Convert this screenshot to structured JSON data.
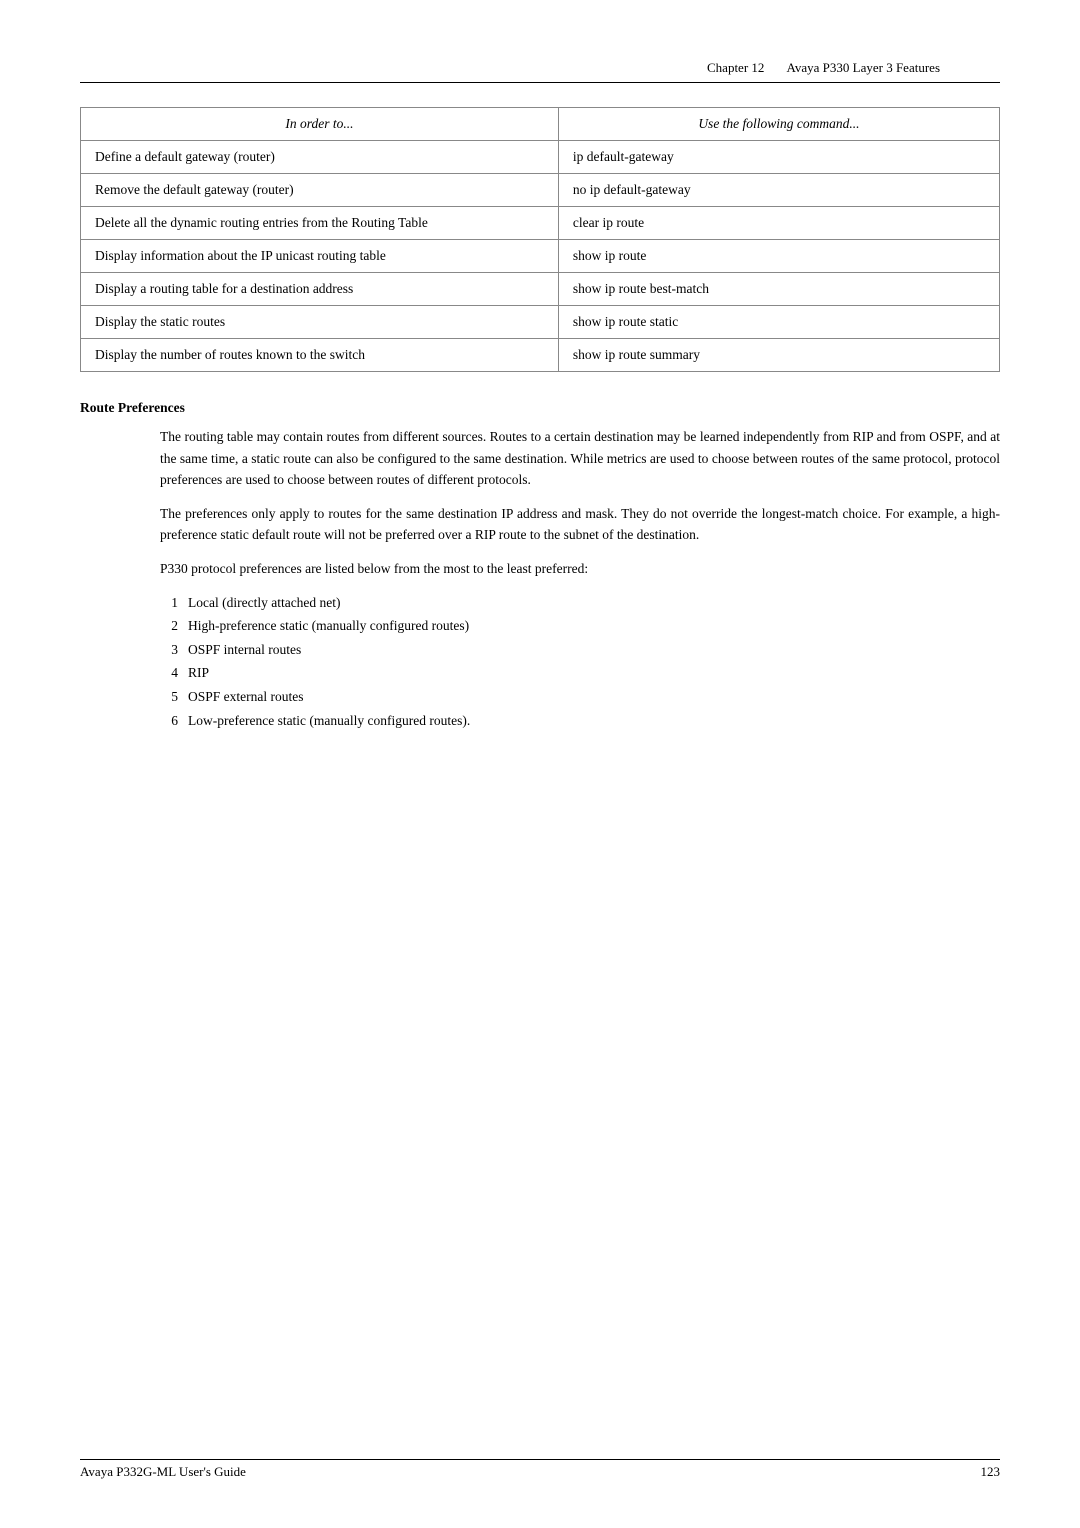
{
  "header": {
    "chapter": "Chapter 12",
    "title": "Avaya P330 Layer 3 Features"
  },
  "table": {
    "col1_header": "In order to...",
    "col2_header": "Use the following command...",
    "rows": [
      {
        "action": "Define a default gateway (router)",
        "command": "ip default-gateway"
      },
      {
        "action": "Remove the default gateway (router)",
        "command": "no ip default-gateway"
      },
      {
        "action": "Delete all the dynamic routing entries from the Routing Table",
        "command": "clear ip route"
      },
      {
        "action": "Display information about the IP unicast routing table",
        "command": "show ip route"
      },
      {
        "action": "Display a routing table for a destination address",
        "command": "show ip route best-match"
      },
      {
        "action": "Display the static routes",
        "command": "show ip route static"
      },
      {
        "action": "Display the number of routes known to the switch",
        "command": "show ip route summary"
      }
    ]
  },
  "route_preferences": {
    "heading": "Route Preferences",
    "paragraph1": "The routing table may contain routes from different sources. Routes to a certain destination may be learned independently from RIP and from OSPF, and at the same time, a static route can also be configured to the same destination. While metrics are used to choose between routes of the same protocol, protocol preferences are used to choose between routes of different protocols.",
    "paragraph2": "The preferences only apply to routes for the same destination IP address and mask. They do not override the longest-match choice. For example, a high-preference static default route will not be preferred over a RIP route to the subnet of the destination.",
    "paragraph3": "P330 protocol preferences are listed below from the most to the least preferred:",
    "items": [
      {
        "num": "1",
        "text": "Local (directly attached net)"
      },
      {
        "num": "2",
        "text": "High-preference static (manually configured routes)"
      },
      {
        "num": "3",
        "text": "OSPF internal routes"
      },
      {
        "num": "4",
        "text": "RIP"
      },
      {
        "num": "5",
        "text": "OSPF external routes"
      },
      {
        "num": "6",
        "text": "Low-preference static (manually configured routes)."
      }
    ]
  },
  "footer": {
    "left": "Avaya P332G-ML User's Guide",
    "right": "123"
  }
}
